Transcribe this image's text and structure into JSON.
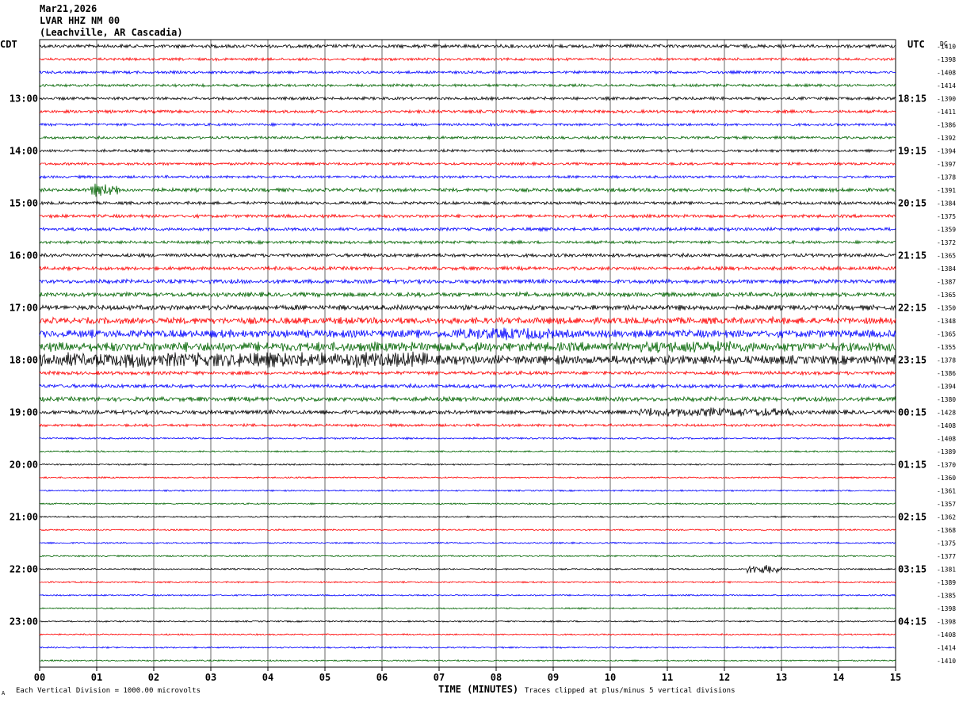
{
  "header": {
    "date": "Mar21,2026",
    "station": "LVAR HHZ NM 00",
    "location": "(Leachville, AR Cascadia)"
  },
  "footer": {
    "scale_note": "Each Vertical Division = 1000.00 microvolts",
    "clip_note": "Traces clipped at plus/minus 5 vertical divisions",
    "corner_mark": "A"
  },
  "colors": {
    "trace_cycle": [
      "#000000",
      "#ff0000",
      "#0000ff",
      "#006400"
    ],
    "grid": "#000000"
  },
  "chart_data": {
    "type": "line",
    "title": "",
    "xlabel": "TIME (MINUTES)",
    "x_ticks": [
      "00",
      "01",
      "02",
      "03",
      "04",
      "05",
      "06",
      "07",
      "08",
      "09",
      "10",
      "11",
      "12",
      "13",
      "14",
      "15"
    ],
    "xlim": [
      0,
      15
    ],
    "left_axis_label": "CDT",
    "right_axis_label": "UTC",
    "dc_label": "DC",
    "left_hour_labels": [
      "13:00",
      "14:00",
      "15:00",
      "16:00",
      "17:00",
      "18:00",
      "19:00",
      "20:00",
      "21:00",
      "22:00",
      "23:00"
    ],
    "right_hour_labels": [
      "18:15",
      "19:15",
      "20:15",
      "21:15",
      "22:15",
      "23:15",
      "00:15",
      "01:15",
      "02:15",
      "03:15",
      "04:15"
    ],
    "first_hour_label_row": 4,
    "rows_per_hour": 4,
    "dc_offsets": [
      "-1410",
      "-1398",
      "-1408",
      "-1414",
      "-1390",
      "-1411",
      "-1386",
      "-1392",
      "-1394",
      "-1397",
      "-1378",
      "-1391",
      "-1384",
      "-1375",
      "-1359",
      "-1372",
      "-1365",
      "-1384",
      "-1387",
      "-1365",
      "-1350",
      "-1348",
      "-1365",
      "-1355",
      "-1378",
      "-1386",
      "-1394",
      "-1380",
      "-1428",
      "-1408",
      "-1408",
      "-1389",
      "-1370",
      "-1360",
      "-1361",
      "-1357",
      "-1362",
      "-1368",
      "-1375",
      "-1377",
      "-1381",
      "-1389",
      "-1385",
      "-1398",
      "-1398",
      "-1408",
      "-1414",
      "-1410"
    ],
    "trace_amplitude": [
      1.2,
      0.9,
      0.9,
      0.9,
      1.0,
      1.0,
      0.9,
      0.9,
      0.9,
      0.9,
      0.9,
      1.2,
      1.0,
      1.1,
      1.1,
      1.0,
      1.2,
      1.2,
      1.4,
      1.5,
      1.7,
      2.2,
      2.6,
      3.2,
      3.0,
      1.2,
      1.3,
      1.5,
      1.4,
      0.9,
      0.6,
      0.5,
      0.5,
      0.5,
      0.5,
      0.5,
      0.5,
      0.5,
      0.5,
      0.5,
      0.5,
      0.5,
      0.5,
      0.5,
      0.5,
      0.5,
      0.5,
      0.5
    ],
    "events": [
      {
        "row": 11,
        "minute_start": 0.9,
        "minute_end": 1.4,
        "amplitude": 4
      },
      {
        "row": 24,
        "minute_start": 0.0,
        "minute_end": 6.8,
        "amplitude": 5
      },
      {
        "row": 22,
        "minute_start": 7.2,
        "minute_end": 9.0,
        "amplitude": 4
      },
      {
        "row": 23,
        "minute_start": 10.5,
        "minute_end": 12.5,
        "amplitude": 4
      },
      {
        "row": 28,
        "minute_start": 10.5,
        "minute_end": 13.2,
        "amplitude": 3
      },
      {
        "row": 40,
        "minute_start": 12.4,
        "minute_end": 13.0,
        "amplitude": 3
      }
    ]
  }
}
